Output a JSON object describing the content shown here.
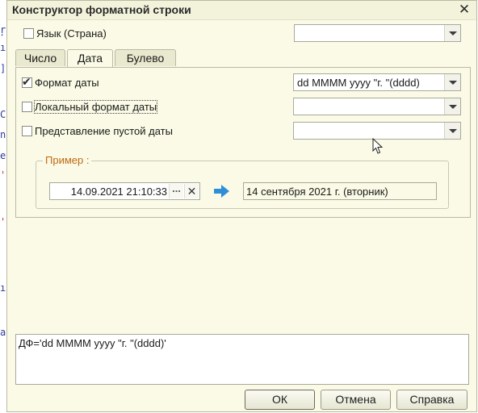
{
  "dialog": {
    "title": "Конструктор форматной строки",
    "close_label": "✕"
  },
  "language": {
    "label": "Язык (Страна)",
    "checked": false,
    "value": ""
  },
  "tabs": [
    {
      "label": "Число",
      "active": false
    },
    {
      "label": "Дата",
      "active": true
    },
    {
      "label": "Булево",
      "active": false
    }
  ],
  "date_tab": {
    "date_format": {
      "label": "Формат даты",
      "checked": true,
      "value": "dd MMMM yyyy \"г. \"(dddd)"
    },
    "local_format": {
      "label": "Локальный формат даты",
      "checked": false,
      "value": ""
    },
    "empty_date": {
      "label": "Представление пустой даты",
      "checked": false,
      "value": ""
    }
  },
  "example": {
    "title": "Пример :",
    "input_value": "14.09.2021 21:10:33",
    "ellipsis_label": "...",
    "clear_label": "✕",
    "result": "14 сентября 2021 г. (вторник)"
  },
  "format_string": "ДФ='dd MMMM yyyy \"г. \"(dddd)'",
  "buttons": {
    "ok": "ОК",
    "cancel": "Отмена",
    "help": "Справка"
  },
  "colors": {
    "dialog_bg": "#fafae6",
    "group_title": "#c06a11",
    "arrow_icon": "#2e8fd8"
  }
}
